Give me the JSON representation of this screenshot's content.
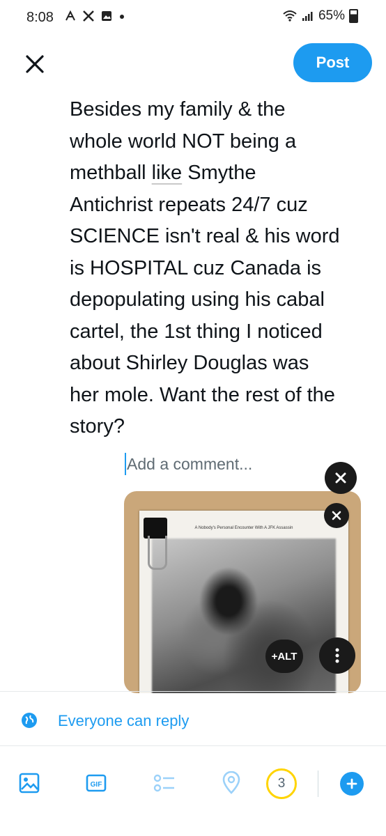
{
  "status_bar": {
    "time": "8:08",
    "battery": "65%"
  },
  "header": {
    "post_label": "Post"
  },
  "tweet": {
    "line1": "Besides my family & the",
    "line2": "whole world NOT being a",
    "line3_pre": "methball ",
    "line3_link": "like",
    "line3_post": " Smythe",
    "line4": "Antichrist repeats 24/7 cuz",
    "line5": "SCIENCE isn't real & his word",
    "line6": "is HOSPITAL cuz Canada is",
    "line7": "depopulating using his cabal",
    "line8": "cartel, the 1st thing I noticed",
    "line9": "about Shirley Douglas was",
    "line10": "her mole. Want the rest of the",
    "line11": "story?"
  },
  "comment": {
    "placeholder": "Add a comment..."
  },
  "media": {
    "paper_title": "A Nobody's Personal Encounter With A JFK Assassin",
    "alt_label": "+ALT"
  },
  "reply_setting": {
    "label": "Everyone can reply"
  },
  "toolbar": {
    "char_counter": "3"
  },
  "colors": {
    "accent": "#1d9bf0",
    "counter_ring": "#ffd400"
  }
}
